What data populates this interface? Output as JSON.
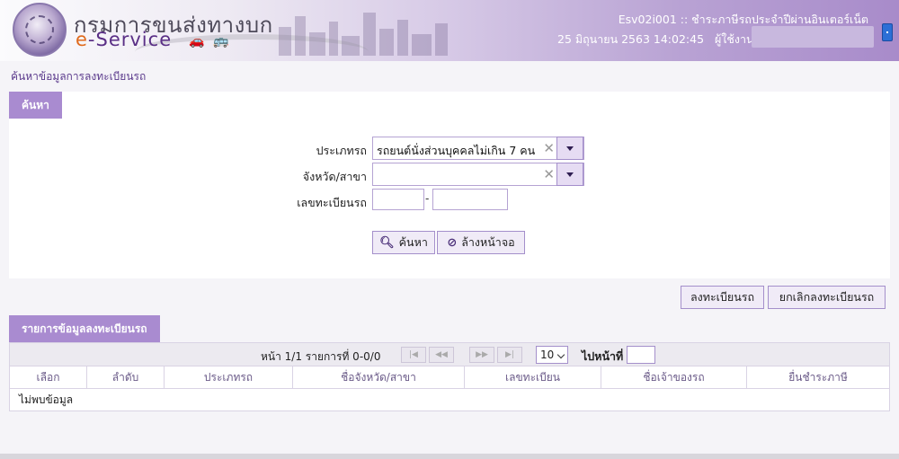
{
  "header": {
    "brand_th": "กรมการขนส่งทางบก",
    "brand_en_prefix": "e",
    "brand_en_suffix": "-Service",
    "screen_code_title": "Esv02i001 :: ชำระภาษีรถประจำปีผ่านอินเตอร์เน็ต",
    "datetime": "25 มิถุนายน 2563 14:02:45",
    "user_label": "ผู้ใช้งาน :"
  },
  "breadcrumb": "ค้นหาข้อมูลการลงทะเบียนรถ",
  "search": {
    "tab_label": "ค้นหา",
    "vehicle_type_label": "ประเภทรถ",
    "vehicle_type_value": "รถยนต์นั่งส่วนบุคคลไม่เกิน 7 คน",
    "province_label": "จังหวัด/สาขา",
    "province_value": "",
    "plate_label": "เลขทะเบียนรถ",
    "plate_dash": "-",
    "search_button": "ค้นหา",
    "clear_button": "ล้างหน้าจอ"
  },
  "actions": {
    "register_button": "ลงทะเบียนรถ",
    "cancel_register_button": "ยกเลิกลงทะเบียนรถ"
  },
  "list": {
    "tab_label": "รายการข้อมูลลงทะเบียนรถ",
    "pager_text": "หน้า 1/1 รายการที่ 0-0/0",
    "rows_per_page": "10",
    "goto_label": "ไปหน้าที่",
    "columns": [
      "เลือก",
      "ลำดับ",
      "ประเภทรถ",
      "ชื่อจังหวัด/สาขา",
      "เลขทะเบียน",
      "ชื่อเจ้าของรถ",
      "ยื่นชำระภาษี"
    ],
    "empty_text": "ไม่พบข้อมูล"
  },
  "colors": {
    "accent": "#a98bd0",
    "header_purple": "#a88bca",
    "brand_orange": "#e06a1d"
  }
}
